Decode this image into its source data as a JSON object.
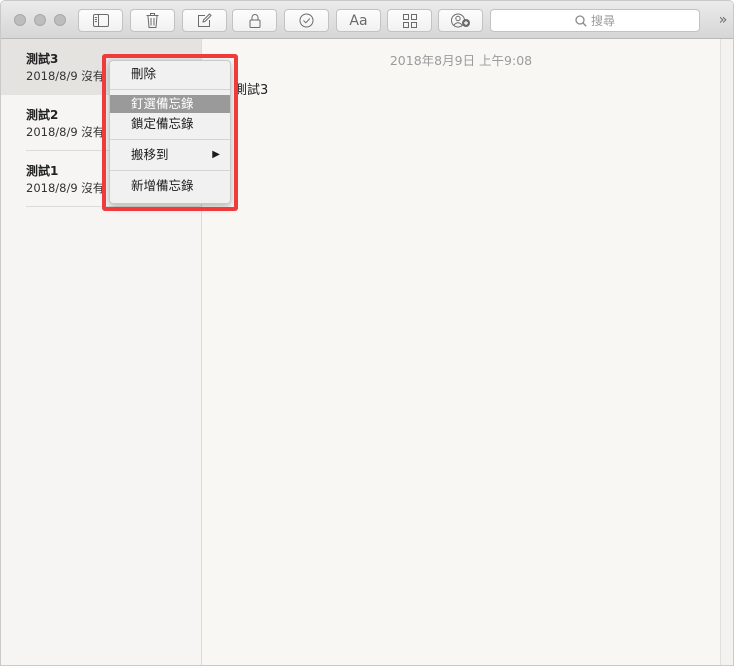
{
  "toolbar": {
    "search_placeholder": "搜尋",
    "format_label": "Aa",
    "overflow": "»"
  },
  "notes": [
    {
      "title": "測試3",
      "subtitle": "2018/8/9  沒有"
    },
    {
      "title": "測試2",
      "subtitle": "2018/8/9  沒有"
    },
    {
      "title": "測試1",
      "subtitle": "2018/8/9  沒有"
    }
  ],
  "editor": {
    "date": "2018年8月9日 上午9:08",
    "text": "測試3"
  },
  "context_menu": {
    "delete": "刪除",
    "pin": "釘選備忘錄",
    "lock": "鎖定備忘錄",
    "move": "搬移到",
    "move_arrow": "▶",
    "new": "新增備忘錄"
  },
  "colors": {
    "highlight_border": "#ee3b3b",
    "menu_selected": "#9a9a9a"
  }
}
